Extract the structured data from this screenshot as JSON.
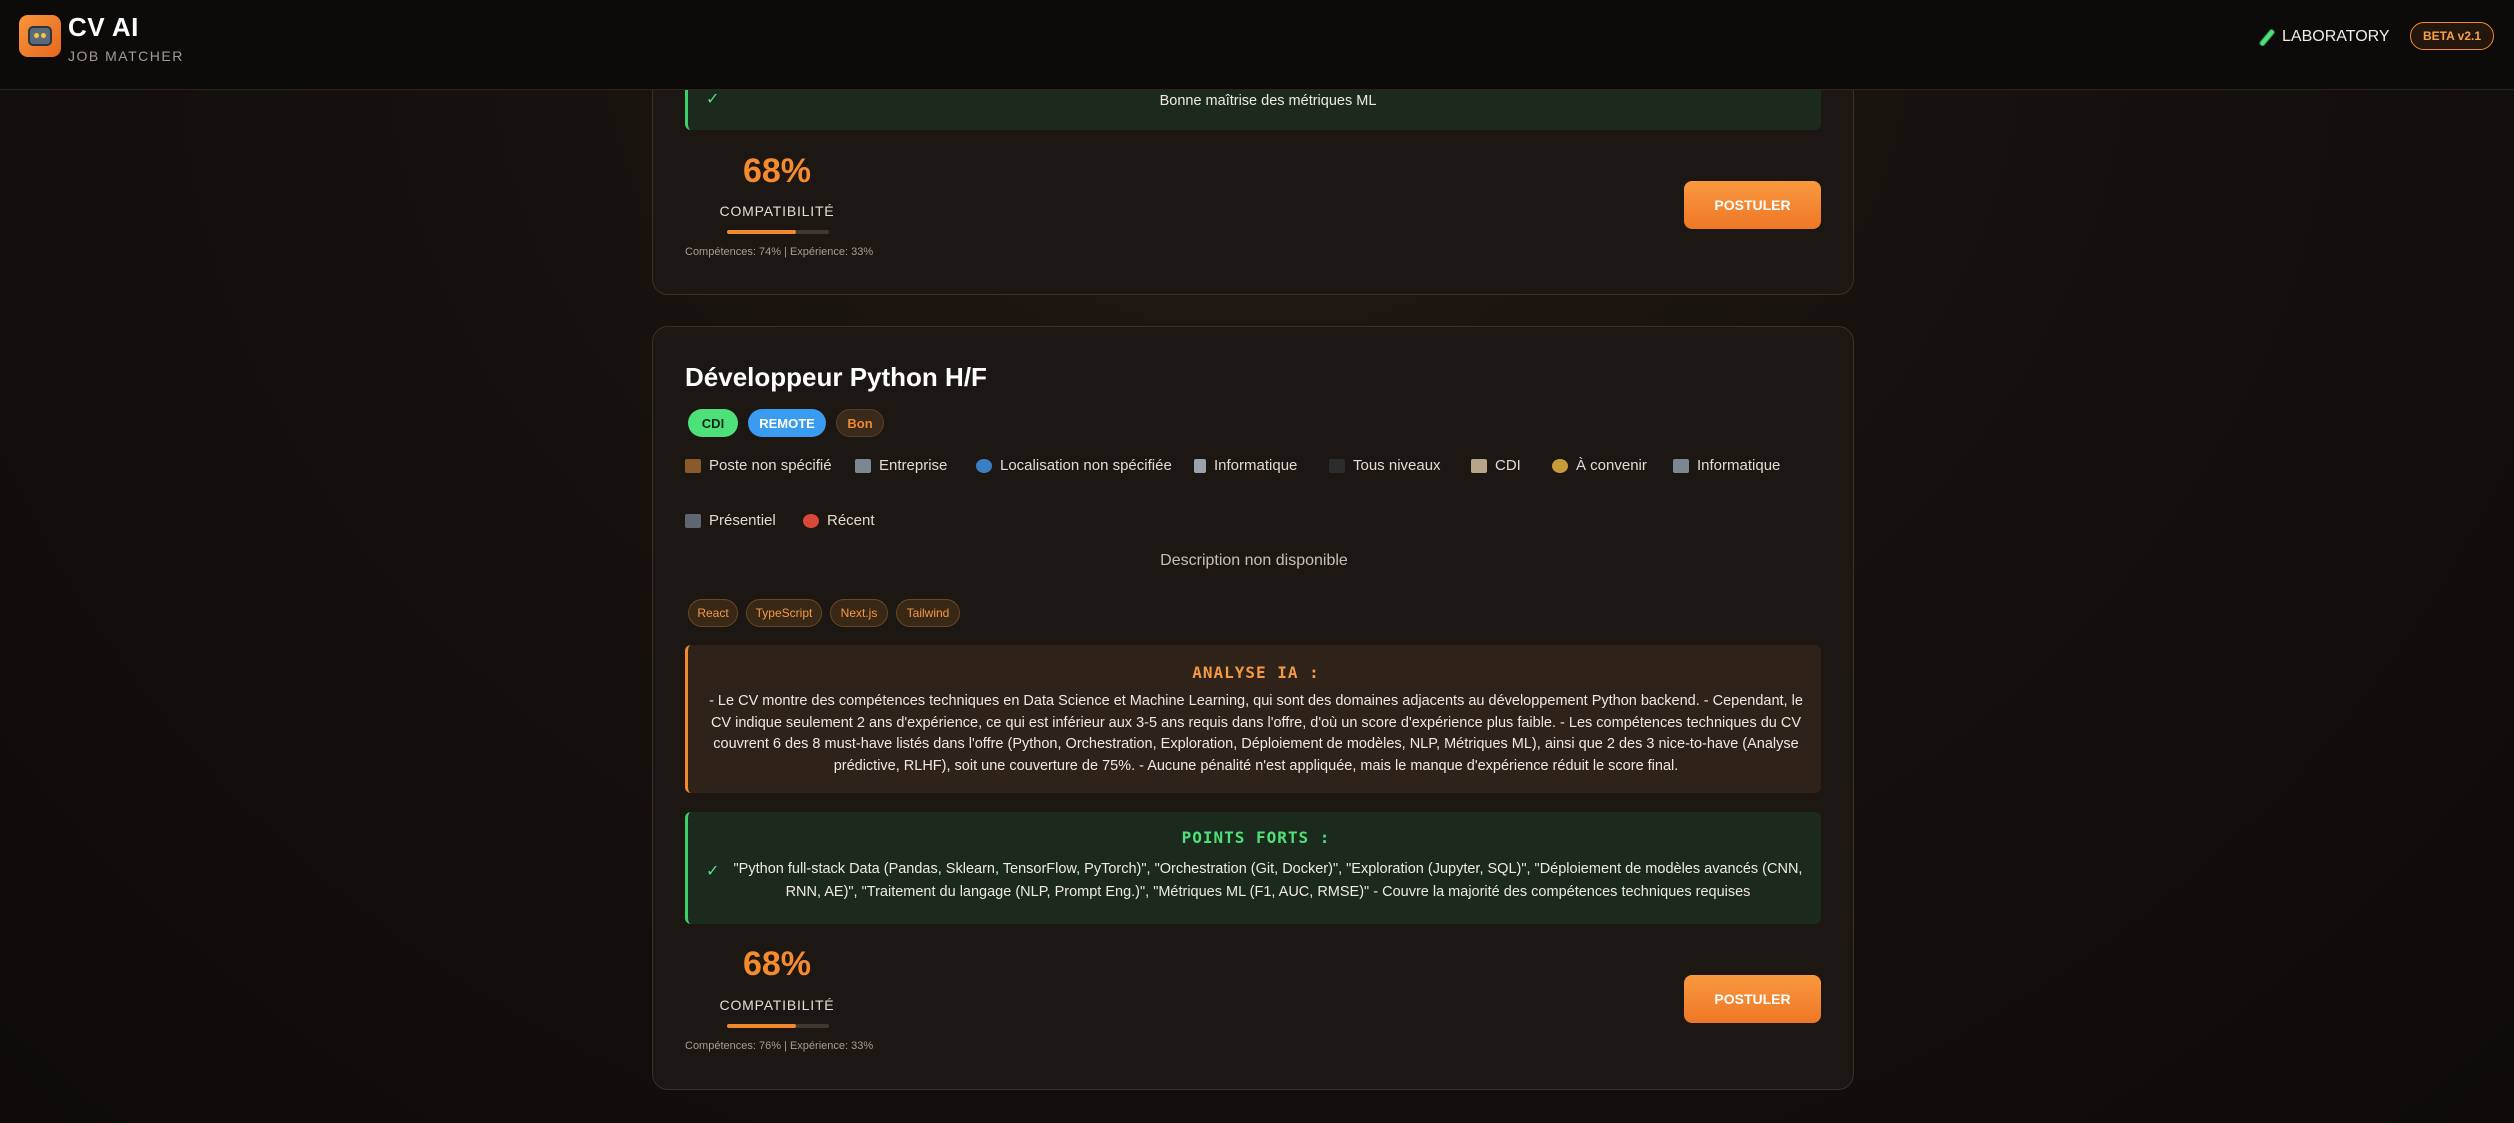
{
  "header": {
    "title": "CV AI",
    "subtitle": "JOB MATCHER",
    "nav_lab": "LABORATORY",
    "beta_badge": "BETA v2.1"
  },
  "card1": {
    "strength_text": "Bonne maîtrise des métriques ML",
    "score": "68%",
    "score_label": "COMPATIBILITÉ",
    "score_fraction": 0.68,
    "score_detail": "Compétences: 74% | Expérience: 33%",
    "apply_label": "POSTULER"
  },
  "card2": {
    "title": "Développeur Python H/F",
    "badges": {
      "contract": "CDI",
      "remote": "REMOTE",
      "level": "Bon"
    },
    "meta": [
      {
        "icon": "briefcase-icon",
        "text": "Poste non spécifié"
      },
      {
        "icon": "building-icon",
        "text": "Entreprise"
      },
      {
        "icon": "globe-icon",
        "text": "Localisation non spécifiée"
      },
      {
        "icon": "wrench-icon",
        "text": "Informatique"
      },
      {
        "icon": "graduation-cap-icon",
        "text": "Tous niveaux"
      },
      {
        "icon": "clipboard-icon",
        "text": "CDI"
      },
      {
        "icon": "money-bag-icon",
        "text": "À convenir"
      },
      {
        "icon": "office-icon",
        "text": "Informatique"
      },
      {
        "icon": "laptop-icon",
        "text": "Présentiel"
      },
      {
        "icon": "alarm-clock-icon",
        "text": "Récent"
      }
    ],
    "description": "Description non disponible",
    "tags": [
      "React",
      "TypeScript",
      "Next.js",
      "Tailwind"
    ],
    "analysis_title": "ANALYSE IA :",
    "analysis_text": "- Le CV montre des compétences techniques en Data Science et Machine Learning, qui sont des domaines adjacents au développement Python backend. - Cependant, le CV indique seulement 2 ans d'expérience, ce qui est inférieur aux 3-5 ans requis dans l'offre, d'où un score d'expérience plus faible. - Les compétences techniques du CV couvrent 6 des 8 must-have listés dans l'offre (Python, Orchestration, Exploration, Déploiement de modèles, NLP, Métriques ML), ainsi que 2 des 3 nice-to-have (Analyse prédictive, RLHF), soit une couverture de 75%. - Aucune pénalité n'est appliquée, mais le manque d'expérience réduit le score final.",
    "strengths_title": "POINTS FORTS :",
    "strength_text": "\"Python full-stack Data (Pandas, Sklearn, TensorFlow, PyTorch)\", \"Orchestration (Git, Docker)\", \"Exploration (Jupyter, SQL)\", \"Déploiement de modèles avancés (CNN, RNN, AE)\", \"Traitement du langage (NLP, Prompt Eng.)\", \"Métriques ML (F1, AUC, RMSE)\" - Couvre la majorité des compétences techniques requises",
    "score": "68%",
    "score_label": "COMPATIBILITÉ",
    "score_fraction": 0.68,
    "score_detail": "Compétences: 76% | Expérience: 33%",
    "apply_label": "POSTULER"
  },
  "colors": {
    "accent": "#f08a2d",
    "success": "#4ee17a",
    "info": "#3a9cf0"
  }
}
